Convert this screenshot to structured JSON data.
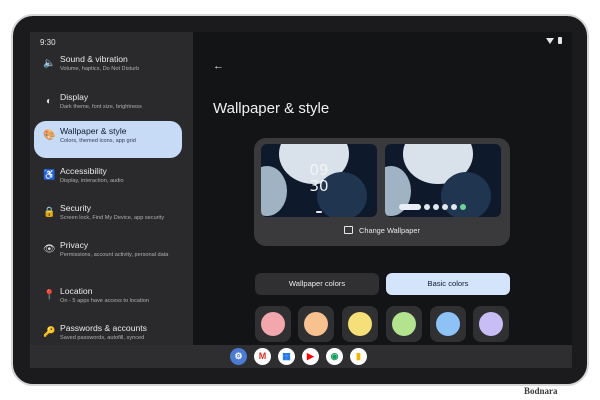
{
  "status": {
    "time": "9:30"
  },
  "settings_items": [
    {
      "title": "Sound & vibration",
      "subtitle": "Volume, haptics, Do Not Disturb",
      "icon": "volume-icon"
    },
    {
      "title": "Display",
      "subtitle": "Dark theme, font size, brightness",
      "icon": "brightness-icon"
    },
    {
      "title": "Wallpaper & style",
      "subtitle": "Colors, themed icons, app grid",
      "icon": "palette-icon",
      "active": true
    },
    {
      "title": "Accessibility",
      "subtitle": "Display, interaction, audio",
      "icon": "accessibility-icon"
    },
    {
      "title": "Security",
      "subtitle": "Screen lock, Find My Device, app security",
      "icon": "lock-icon"
    },
    {
      "title": "Privacy",
      "subtitle": "Permissions, account activity, personal data",
      "icon": "eye-icon"
    },
    {
      "title": "Location",
      "subtitle": "On - 5 apps have access to location",
      "icon": "location-pin-icon"
    },
    {
      "title": "Passwords & accounts",
      "subtitle": "Saved passwords, autofill, synced",
      "icon": "passwords-icon"
    }
  ],
  "page": {
    "title": "Wallpaper & style",
    "lock_clock": "09\n30",
    "change_wallpaper": "Change Wallpaper",
    "tabs": {
      "wallpaper_colors": "Wallpaper colors",
      "basic_colors": "Basic colors"
    },
    "swatches": [
      "#f2a7ad",
      "#f7c190",
      "#f5df78",
      "#b2e38e",
      "#8ec2f6",
      "#c8bdf4"
    ]
  },
  "colors": {
    "accent": "#c7dbf7",
    "background": "#131416",
    "panel": "#2a2a2c"
  },
  "dock_apps": [
    "settings-icon",
    "gmail-icon",
    "calendar-icon",
    "youtube-icon",
    "chrome-icon",
    "keep-icon"
  ],
  "watermark": "Bodnara"
}
